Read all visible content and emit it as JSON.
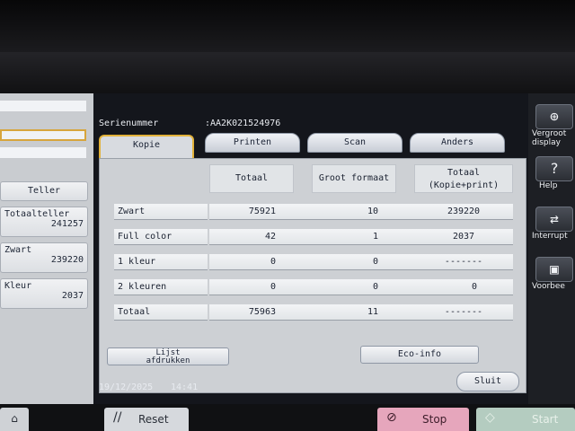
{
  "left_panel": {
    "teller_label": "Teller",
    "counters": [
      {
        "label": "Totaalteller",
        "value": "241257"
      },
      {
        "label": "Zwart",
        "value": "239220"
      },
      {
        "label": "Kleur",
        "value": "2037"
      }
    ]
  },
  "header": {
    "serial_label": "Serienummer",
    "serial_value": ":AA2K021524976"
  },
  "tabs": [
    {
      "label": "Kopie",
      "active": true
    },
    {
      "label": "Printen"
    },
    {
      "label": "Scan"
    },
    {
      "label": "Anders"
    }
  ],
  "table": {
    "columns": [
      "Totaal",
      "Groot formaat",
      "Totaal\n(Kopie+print)"
    ],
    "rows": [
      {
        "label": "Zwart",
        "values": [
          "75921",
          "10",
          "239220"
        ]
      },
      {
        "label": "Full color",
        "values": [
          "42",
          "1",
          "2037"
        ]
      },
      {
        "label": "1 kleur",
        "values": [
          "0",
          "0",
          "-------"
        ]
      },
      {
        "label": "2 kleuren",
        "values": [
          "0",
          "0",
          "0"
        ]
      },
      {
        "label": "Totaal",
        "values": [
          "75963",
          "11",
          "-------"
        ]
      }
    ]
  },
  "buttons": {
    "lijst_afdrukken": "Lijst\nafdrukken",
    "eco_info": "Eco-info",
    "sluit": "Sluit"
  },
  "status": {
    "date": "19/12/2025",
    "time": "14:41"
  },
  "right_sidebar": [
    {
      "icon": "zoom-icon",
      "label": "Vergroot\ndisplay"
    },
    {
      "icon": "help-icon",
      "label": "Help"
    },
    {
      "icon": "interrupt-icon",
      "label": "Interrupt"
    },
    {
      "icon": "preview-icon",
      "label": "Voorbee"
    }
  ],
  "bottom_bar": {
    "reset": "Reset",
    "stop": "Stop",
    "start": "Start"
  }
}
